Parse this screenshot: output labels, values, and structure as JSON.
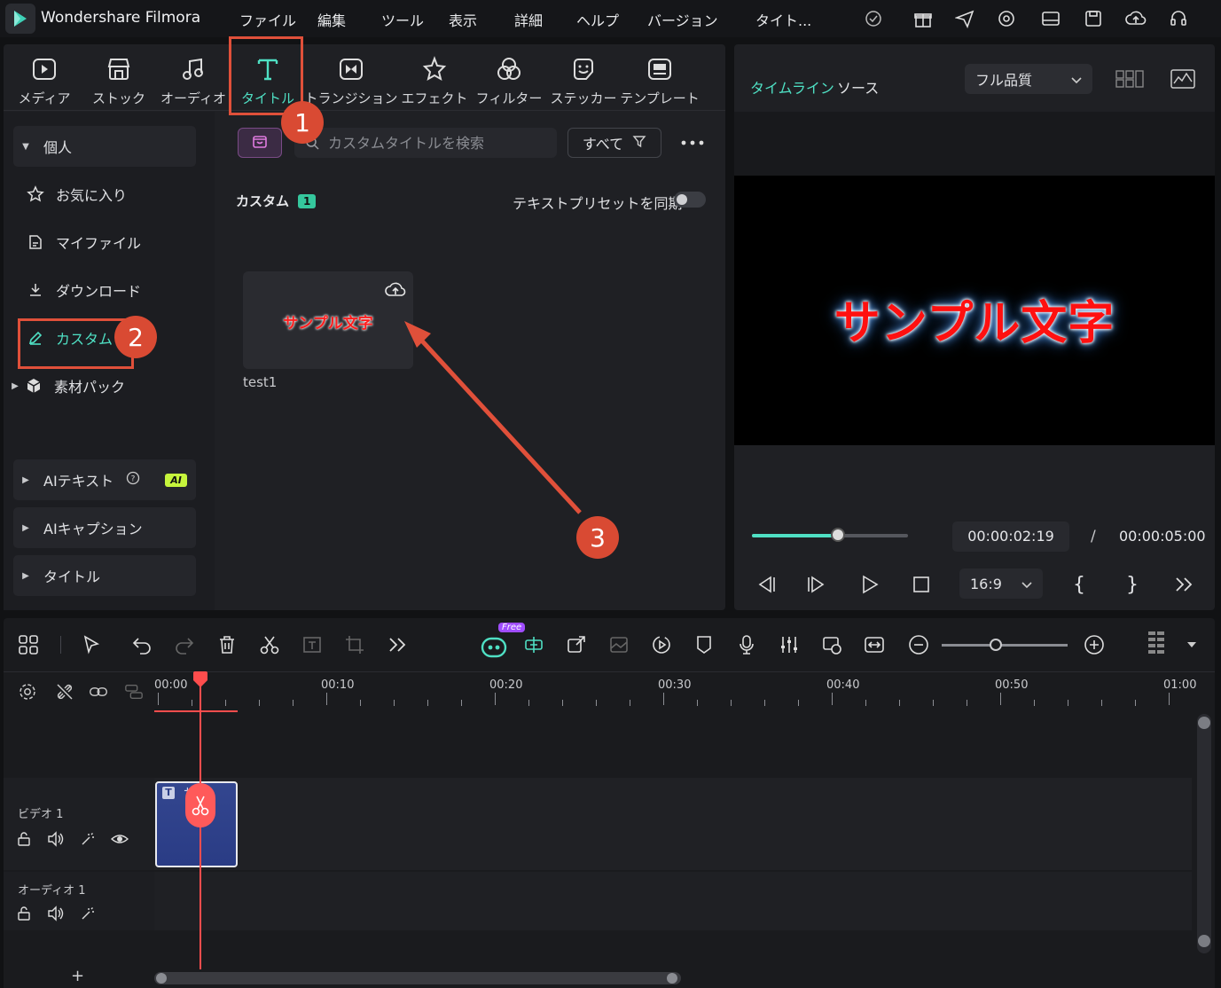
{
  "titlebar": {
    "app_title": "Wondershare Filmora",
    "menu": [
      "ファイル",
      "編集",
      "ツール",
      "表示",
      "詳細",
      "ヘルプ",
      "バージョン"
    ],
    "project_title": "タイト..."
  },
  "categories": [
    {
      "label": "メディア",
      "icon": "media-icon"
    },
    {
      "label": "ストック",
      "icon": "stock-icon"
    },
    {
      "label": "オーディオ",
      "icon": "audio-icon"
    },
    {
      "label": "タイトル",
      "icon": "title-icon",
      "active": true
    },
    {
      "label": "トランジション",
      "icon": "transition-icon"
    },
    {
      "label": "エフェクト",
      "icon": "effect-icon"
    },
    {
      "label": "フィルター",
      "icon": "filter-icon"
    },
    {
      "label": "ステッカー",
      "icon": "sticker-icon"
    },
    {
      "label": "テンプレート",
      "icon": "template-icon"
    }
  ],
  "sidebar": {
    "personal": "個人",
    "favorites": "お気に入り",
    "my_files": "マイファイル",
    "downloads": "ダウンロード",
    "custom": "カスタム",
    "packs": "素材パック",
    "ai_text": "AIテキスト",
    "ai_badge": "AI",
    "ai_caption": "AIキャプション",
    "titles": "タイトル"
  },
  "content": {
    "search_placeholder": "カスタムタイトルを検索",
    "filter_label": "すべて",
    "section_label": "カスタム",
    "section_count": "1",
    "sync_label": "テキストプリセットを同期",
    "card_text": "サンプル文字",
    "card_name": "test1"
  },
  "preview": {
    "tab_timeline": "タイムライン",
    "tab_source": "ソース",
    "quality": "フル品質",
    "canvas_text": "サンプル文字",
    "progress": 0.55,
    "time_current": "00:00:02:19",
    "time_sep": "/",
    "time_total": "00:00:05:00",
    "ratio": "16:9",
    "mark_in": "{",
    "mark_out": "}"
  },
  "timeline": {
    "ruler": [
      "00:00",
      "00:10",
      "00:20",
      "00:30",
      "00:40",
      "00:50",
      "01:00"
    ],
    "video_track": "ビデオ 1",
    "audio_track": "オーディオ 1",
    "clip_label": "サ  字",
    "clip_type": "T",
    "free_badge": "Free",
    "add_track": "+"
  },
  "annotations": [
    "1",
    "2",
    "3"
  ],
  "colors": {
    "accent": "#4fe0c4",
    "annotation": "#d94a33",
    "playhead": "#ff4d4d"
  }
}
